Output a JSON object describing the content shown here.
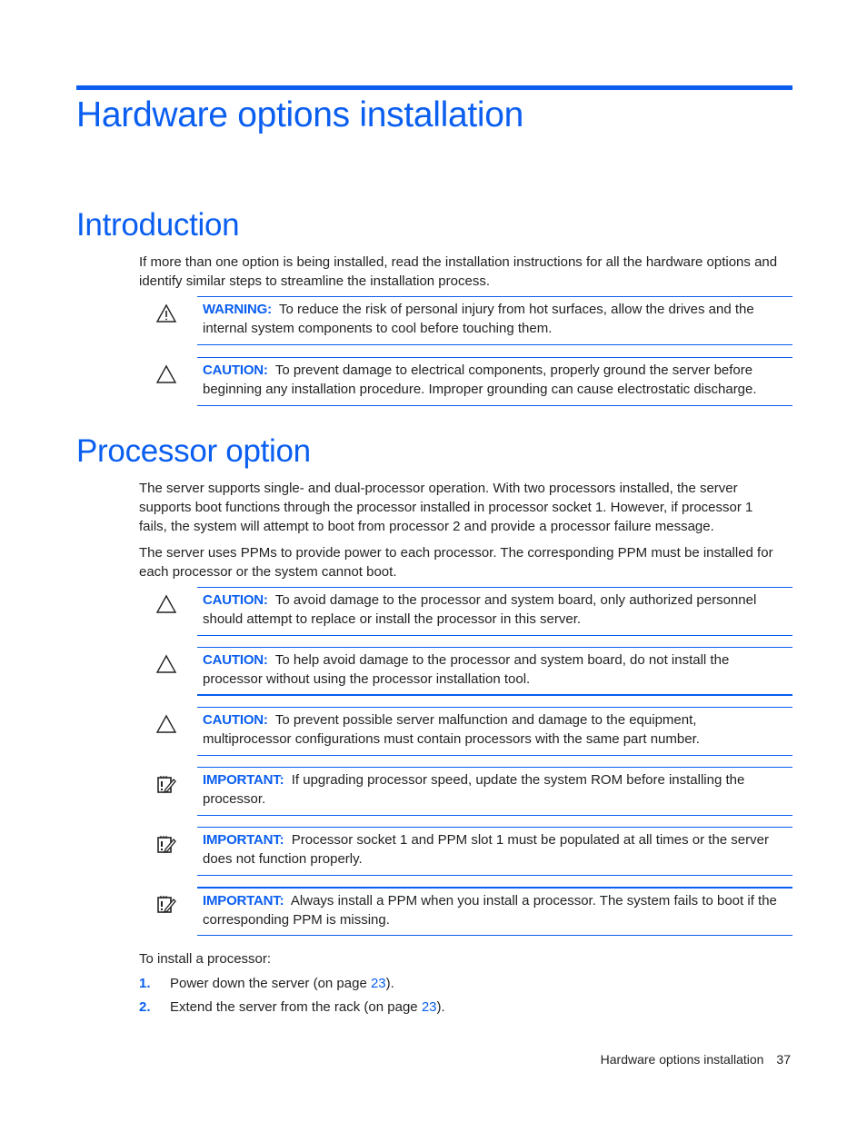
{
  "chapter_title": "Hardware options installation",
  "sections": {
    "introduction": {
      "heading": "Introduction",
      "paragraph": "If more than one option is being installed, read the installation instructions for all the hardware options and identify similar steps to streamline the installation process.",
      "notes": [
        {
          "type": "warning-icon",
          "label": "WARNING:",
          "text": "To reduce the risk of personal injury from hot surfaces, allow the drives and the internal system components to cool before touching them."
        },
        {
          "type": "caution-icon",
          "label": "CAUTION:",
          "text": "To prevent damage to electrical components, properly ground the server before beginning any installation procedure. Improper grounding can cause electrostatic discharge."
        }
      ]
    },
    "processor": {
      "heading": "Processor option",
      "paragraphs": [
        "The server supports single- and dual-processor operation. With two processors installed, the server supports boot functions through the processor installed in processor socket 1. However, if processor 1 fails, the system will attempt to boot from processor 2 and provide a processor failure message.",
        "The server uses PPMs to provide power to each processor. The corresponding PPM must be installed for each processor or the system cannot boot."
      ],
      "notes": [
        {
          "type": "caution-icon",
          "label": "CAUTION:",
          "text": "To avoid damage to the processor and system board, only authorized personnel should attempt to replace or install the processor in this server."
        },
        {
          "type": "caution-icon",
          "label": "CAUTION:",
          "text": "To help avoid damage to the processor and system board, do not install the processor without using the processor installation tool."
        },
        {
          "type": "caution-icon",
          "label": "CAUTION:",
          "text": "To prevent possible server malfunction and damage to the equipment, multiprocessor configurations must contain processors with the same part number."
        },
        {
          "type": "important-icon",
          "label": "IMPORTANT:",
          "text": "If upgrading processor speed, update the system ROM before installing the processor."
        },
        {
          "type": "important-icon",
          "label": "IMPORTANT:",
          "text": "Processor socket 1 and PPM slot 1 must be populated at all times or the server does not function properly."
        },
        {
          "type": "important-icon",
          "label": "IMPORTANT:",
          "text": "Always install a PPM when you install a processor. The system fails to boot if the corresponding PPM is missing."
        }
      ],
      "procedure_intro": "To install a processor:",
      "steps": [
        {
          "num": "1.",
          "text_before": "Power down the server (on page ",
          "link": "23",
          "text_after": ")."
        },
        {
          "num": "2.",
          "text_before": "Extend the server from the rack (on page ",
          "link": "23",
          "text_after": ")."
        }
      ]
    }
  },
  "footer": {
    "section": "Hardware options installation",
    "page": "37"
  },
  "colors": {
    "accent": "#0a5ef0",
    "text": "#222222"
  }
}
